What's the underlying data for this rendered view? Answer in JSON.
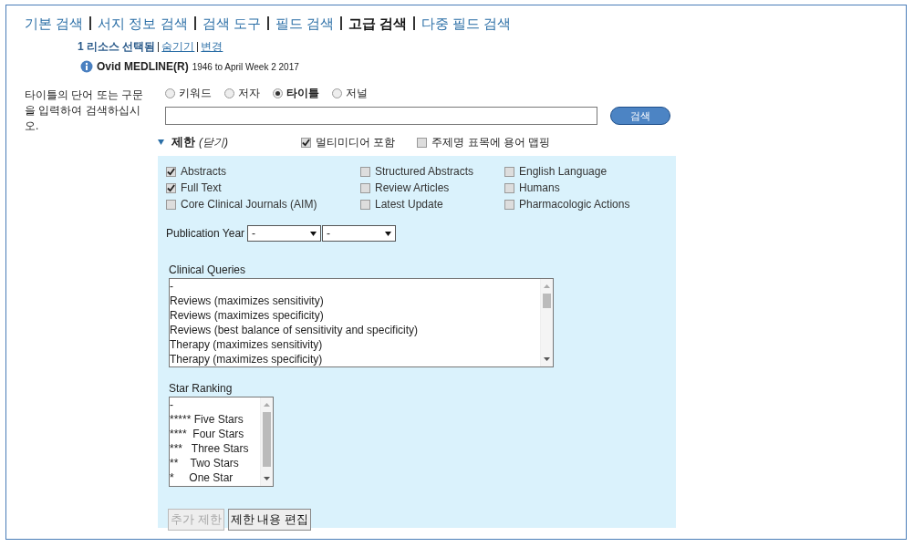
{
  "tabs": [
    {
      "label": "기본 검색",
      "selected": false
    },
    {
      "label": "서지 정보 검색",
      "selected": false
    },
    {
      "label": "검색 도구",
      "selected": false
    },
    {
      "label": "필드 검색",
      "selected": false
    },
    {
      "label": "고급 검색",
      "selected": true
    },
    {
      "label": "다중 필드 검색",
      "selected": false
    }
  ],
  "resources": {
    "count": "1",
    "selected_label": "리소스 선택됨",
    "links": [
      "숨기기",
      "변경"
    ],
    "database": "Ovid MEDLINE(R)",
    "coverage": "1946 to April Week 2 2017"
  },
  "search": {
    "prompt": "타이틀의 단어 또는 구문을 입력하여 검색하십시오.",
    "modes": [
      {
        "label": "키워드",
        "selected": false
      },
      {
        "label": "저자",
        "selected": false
      },
      {
        "label": "타이틀",
        "selected": true
      },
      {
        "label": "저널",
        "selected": false
      }
    ],
    "button": "검색"
  },
  "limits": {
    "title": "제한",
    "toggle": "(닫기)",
    "expanded": true,
    "options": [
      {
        "label": "멀티미디어 포함",
        "checked": true
      },
      {
        "label": "주제명 표목에 용어 맵핑",
        "checked": false
      }
    ],
    "checkboxes": [
      {
        "label": "Abstracts",
        "checked": true
      },
      {
        "label": "Full Text",
        "checked": true
      },
      {
        "label": "Core Clinical Journals (AIM)",
        "checked": false
      },
      {
        "label": "Structured Abstracts",
        "checked": false
      },
      {
        "label": "Review Articles",
        "checked": false
      },
      {
        "label": "Latest Update",
        "checked": false
      },
      {
        "label": "English Language",
        "checked": false
      },
      {
        "label": "Humans",
        "checked": false
      },
      {
        "label": "Pharmacologic Actions",
        "checked": false
      }
    ],
    "publication_year": {
      "label": "Publication Year",
      "from": "-",
      "to": "-"
    },
    "clinical_queries": {
      "label": "Clinical Queries",
      "items": [
        "-",
        "Reviews (maximizes sensitivity)",
        "Reviews (maximizes specificity)",
        "Reviews (best balance of sensitivity and specificity)",
        "Therapy (maximizes sensitivity)",
        "Therapy (maximizes specificity)"
      ]
    },
    "star_ranking": {
      "label": "Star Ranking",
      "items": [
        "-",
        "***** Five Stars",
        "****  Four Stars",
        "***   Three Stars",
        "**    Two Stars",
        "*     One Star"
      ]
    },
    "buttons": [
      {
        "label": "추가 제한",
        "disabled": true
      },
      {
        "label": "제한 내용 편집",
        "disabled": false
      }
    ]
  }
}
